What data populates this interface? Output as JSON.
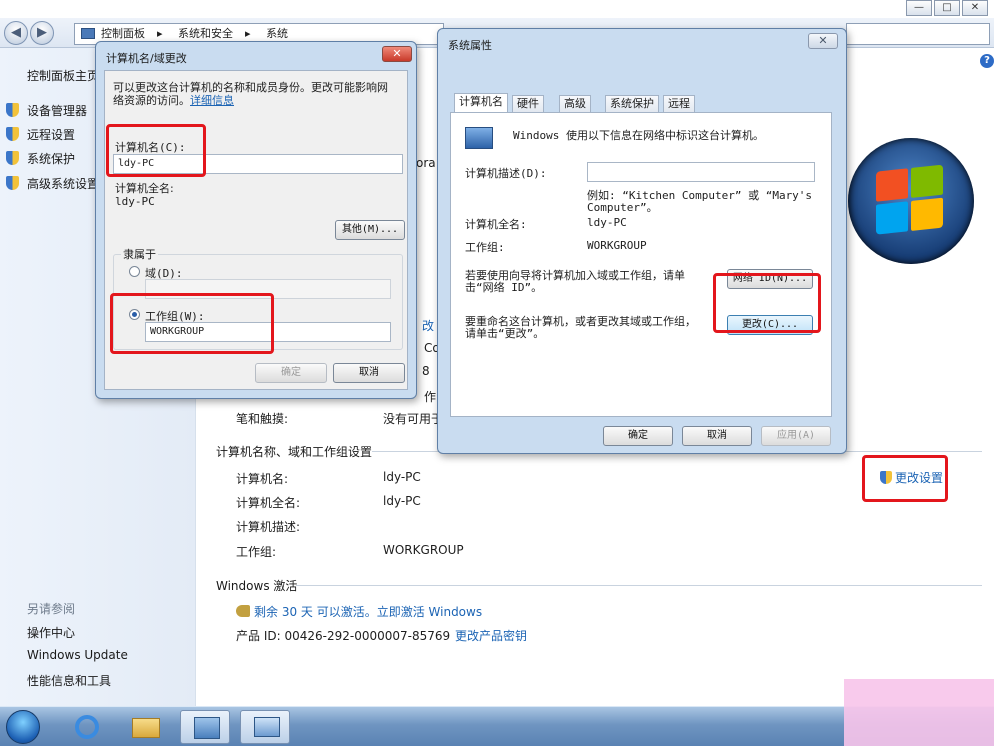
{
  "window": {
    "breadcrumb": [
      "控制面板",
      "系统和安全",
      "系统"
    ],
    "controls": [
      "—",
      "□",
      "✕"
    ],
    "help": "?"
  },
  "sidebar": {
    "home": "控制面板主页",
    "items": [
      {
        "label": "设备管理器"
      },
      {
        "label": "远程设置"
      },
      {
        "label": "系统保护"
      },
      {
        "label": "高级系统设置"
      }
    ],
    "see_also_title": "另请参阅",
    "see_also": [
      "操作中心",
      "Windows Update",
      "性能信息和工具"
    ]
  },
  "main": {
    "partial": {
      "p1": "ora",
      "p2": "改",
      "p3": "Co",
      "p4": "8",
      "p5": "作",
      "pen_label": "笔和触摸:",
      "pen_value": "没有可用于"
    },
    "name_section": {
      "title": "计算机名称、域和工作组设置",
      "rows": [
        {
          "key": "计算机名:",
          "value": "ldy-PC"
        },
        {
          "key": "计算机全名:",
          "value": "ldy-PC"
        },
        {
          "key": "计算机描述:",
          "value": ""
        },
        {
          "key": "工作组:",
          "value": "WORKGROUP"
        }
      ],
      "change_settings": "更改设置"
    },
    "activation": {
      "title": "Windows 激活",
      "status": "剩余 30 天 可以激活。立即激活 Windows",
      "product_id": "产品 ID: 00426-292-0000007-85769",
      "change_key": "更改产品密钥"
    }
  },
  "dialog_rename": {
    "title": "计算机名/域更改",
    "close": "✕",
    "intro": [
      "可以更改这台计算机的名称和成员身份。更改可能影响网",
      "络资源的访问。"
    ],
    "details_link": "详细信息",
    "computer_name_label": "计算机名(C):",
    "computer_name_value": "ldy-PC",
    "full_name_label": "计算机全名:",
    "full_name_value": "ldy-PC",
    "more_button": "其他(M)...",
    "member_of": "隶属于",
    "domain_label": "域(D):",
    "domain_value": "",
    "workgroup_label": "工作组(W):",
    "workgroup_value": "WORKGROUP",
    "ok": "确定",
    "cancel": "取消"
  },
  "dialog_props": {
    "title": "系统属性",
    "close": "✕",
    "tabs": [
      "计算机名",
      "硬件",
      "高级",
      "系统保护",
      "远程"
    ],
    "intro": "Windows 使用以下信息在网络中标识这台计算机。",
    "desc_label": "计算机描述(D):",
    "desc_value": "",
    "example": [
      "例如: “Kitchen Computer” 或 “Mary's",
      "Computer”。"
    ],
    "full_name_label": "计算机全名:",
    "full_name_value": "ldy-PC",
    "workgroup_label": "工作组:",
    "workgroup_value": "WORKGROUP",
    "network_text": [
      "若要使用向导将计算机加入域或工作组，请单",
      "击“网络 ID”。"
    ],
    "network_button": "网络 ID(N)...",
    "rename_text": [
      "要重命名这台计算机，或者更改其域或工作组，",
      "请单击“更改”。"
    ],
    "change_button": "更改(C)...",
    "ok": "确定",
    "cancel": "取消",
    "apply": "应用(A)"
  },
  "colors": {
    "highlight": "#e3161c",
    "link": "#1c64b4"
  },
  "icons": [
    "back-icon",
    "forward-icon",
    "computer-icon",
    "shield-icon",
    "windows-logo",
    "key-icon",
    "help-icon",
    "start-orb",
    "ie-icon",
    "folder-icon",
    "control-panel-icon",
    "system-icon"
  ]
}
